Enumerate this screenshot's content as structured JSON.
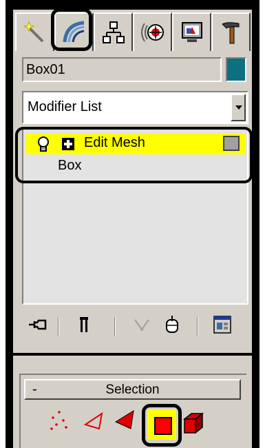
{
  "tabs": [
    {
      "icon": "create-wand-icon"
    },
    {
      "icon": "modify-arc-icon",
      "active": true
    },
    {
      "icon": "hierarchy-icon"
    },
    {
      "icon": "motion-icon"
    },
    {
      "icon": "display-monitor-icon"
    },
    {
      "icon": "utilities-hammer-icon"
    }
  ],
  "object": {
    "name": "Box01",
    "color": "#0d6f80"
  },
  "modifier_list": {
    "label": "Modifier List"
  },
  "stack": {
    "items": [
      {
        "label": "Edit Mesh",
        "selected": true
      },
      {
        "label": "Box",
        "selected": false
      }
    ]
  },
  "selection": {
    "minus": "-",
    "title": "Selection"
  },
  "colors": {
    "panel_bg": "#d4d0c8",
    "stack_highlight": "#ffff00",
    "accent_red": "#ff0000"
  }
}
